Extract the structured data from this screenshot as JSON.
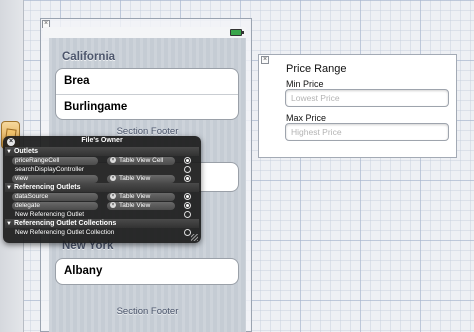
{
  "table_view": {
    "sections": [
      {
        "header": "California",
        "cells": [
          "Brea",
          "Burlingame"
        ],
        "footer": "Section Footer"
      },
      {
        "header": "New York",
        "cells": [
          "Albany"
        ],
        "footer": "Section Footer"
      }
    ]
  },
  "price_range_cell": {
    "title": "Price Range",
    "min_label": "Min Price",
    "min_placeholder": "Lowest Price",
    "max_label": "Max Price",
    "max_placeholder": "Highest Price"
  },
  "connections_hud": {
    "title": "File's Owner",
    "close_glyph": "×",
    "outlets_header": "Outlets",
    "outlets": [
      {
        "name": "priceRangeCell",
        "target": "Table View Cell",
        "connected": true
      },
      {
        "name": "searchDisplayController",
        "target": "",
        "connected": false
      },
      {
        "name": "view",
        "target": "Table View",
        "connected": true
      }
    ],
    "referencing_header": "Referencing Outlets",
    "referencing": [
      {
        "name": "dataSource",
        "target": "Table View",
        "connected": true
      },
      {
        "name": "delegate",
        "target": "Table View",
        "connected": true
      },
      {
        "name": "New Referencing Outlet",
        "target": "",
        "connected": false
      }
    ],
    "collections_header": "Referencing Outlet Collections",
    "collections": [
      {
        "name": "New Referencing Outlet Collection",
        "target": "",
        "connected": false
      }
    ]
  },
  "colors": {
    "table_background": "#c5ccd4",
    "section_header_text": "#4c566c",
    "hud_background": "#1c1c1c",
    "battery": "#3aa64c"
  },
  "icons": [
    "close-icon",
    "battery-icon",
    "disclosure-triangle-icon",
    "connection-circle-icon",
    "files-owner-cube-icon"
  ]
}
